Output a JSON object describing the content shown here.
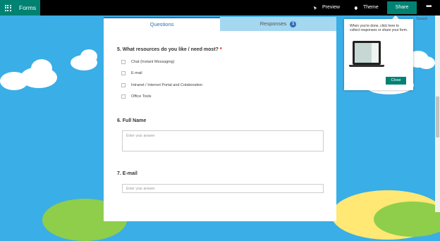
{
  "topbar": {
    "app_name": "Forms",
    "preview_label": "Preview",
    "theme_label": "Theme",
    "share_label": "Share",
    "more_label": "•••",
    "saved_label": "Saved"
  },
  "tabs": {
    "questions_label": "Questions",
    "responses_label": "Responses",
    "responses_badge": "1"
  },
  "questions": [
    {
      "title": "5. What resources do you like / need most?",
      "required_marker": "*",
      "options": [
        "Chat (Instant Messaging)",
        "E-mail",
        "Intranet / Internet Portal and Colaboration",
        "Office Tools"
      ]
    },
    {
      "title": "6. Full Name",
      "placeholder": "Enter your answer"
    },
    {
      "title": "7. E-mail",
      "placeholder": "Enter your answer"
    }
  ],
  "popover": {
    "text": "When you're done, click here to collect responses or share your form.",
    "close_label": "Close"
  },
  "colors": {
    "brand": "#008272",
    "accent": "#2e6fb7",
    "sky": "#3aaee6"
  }
}
